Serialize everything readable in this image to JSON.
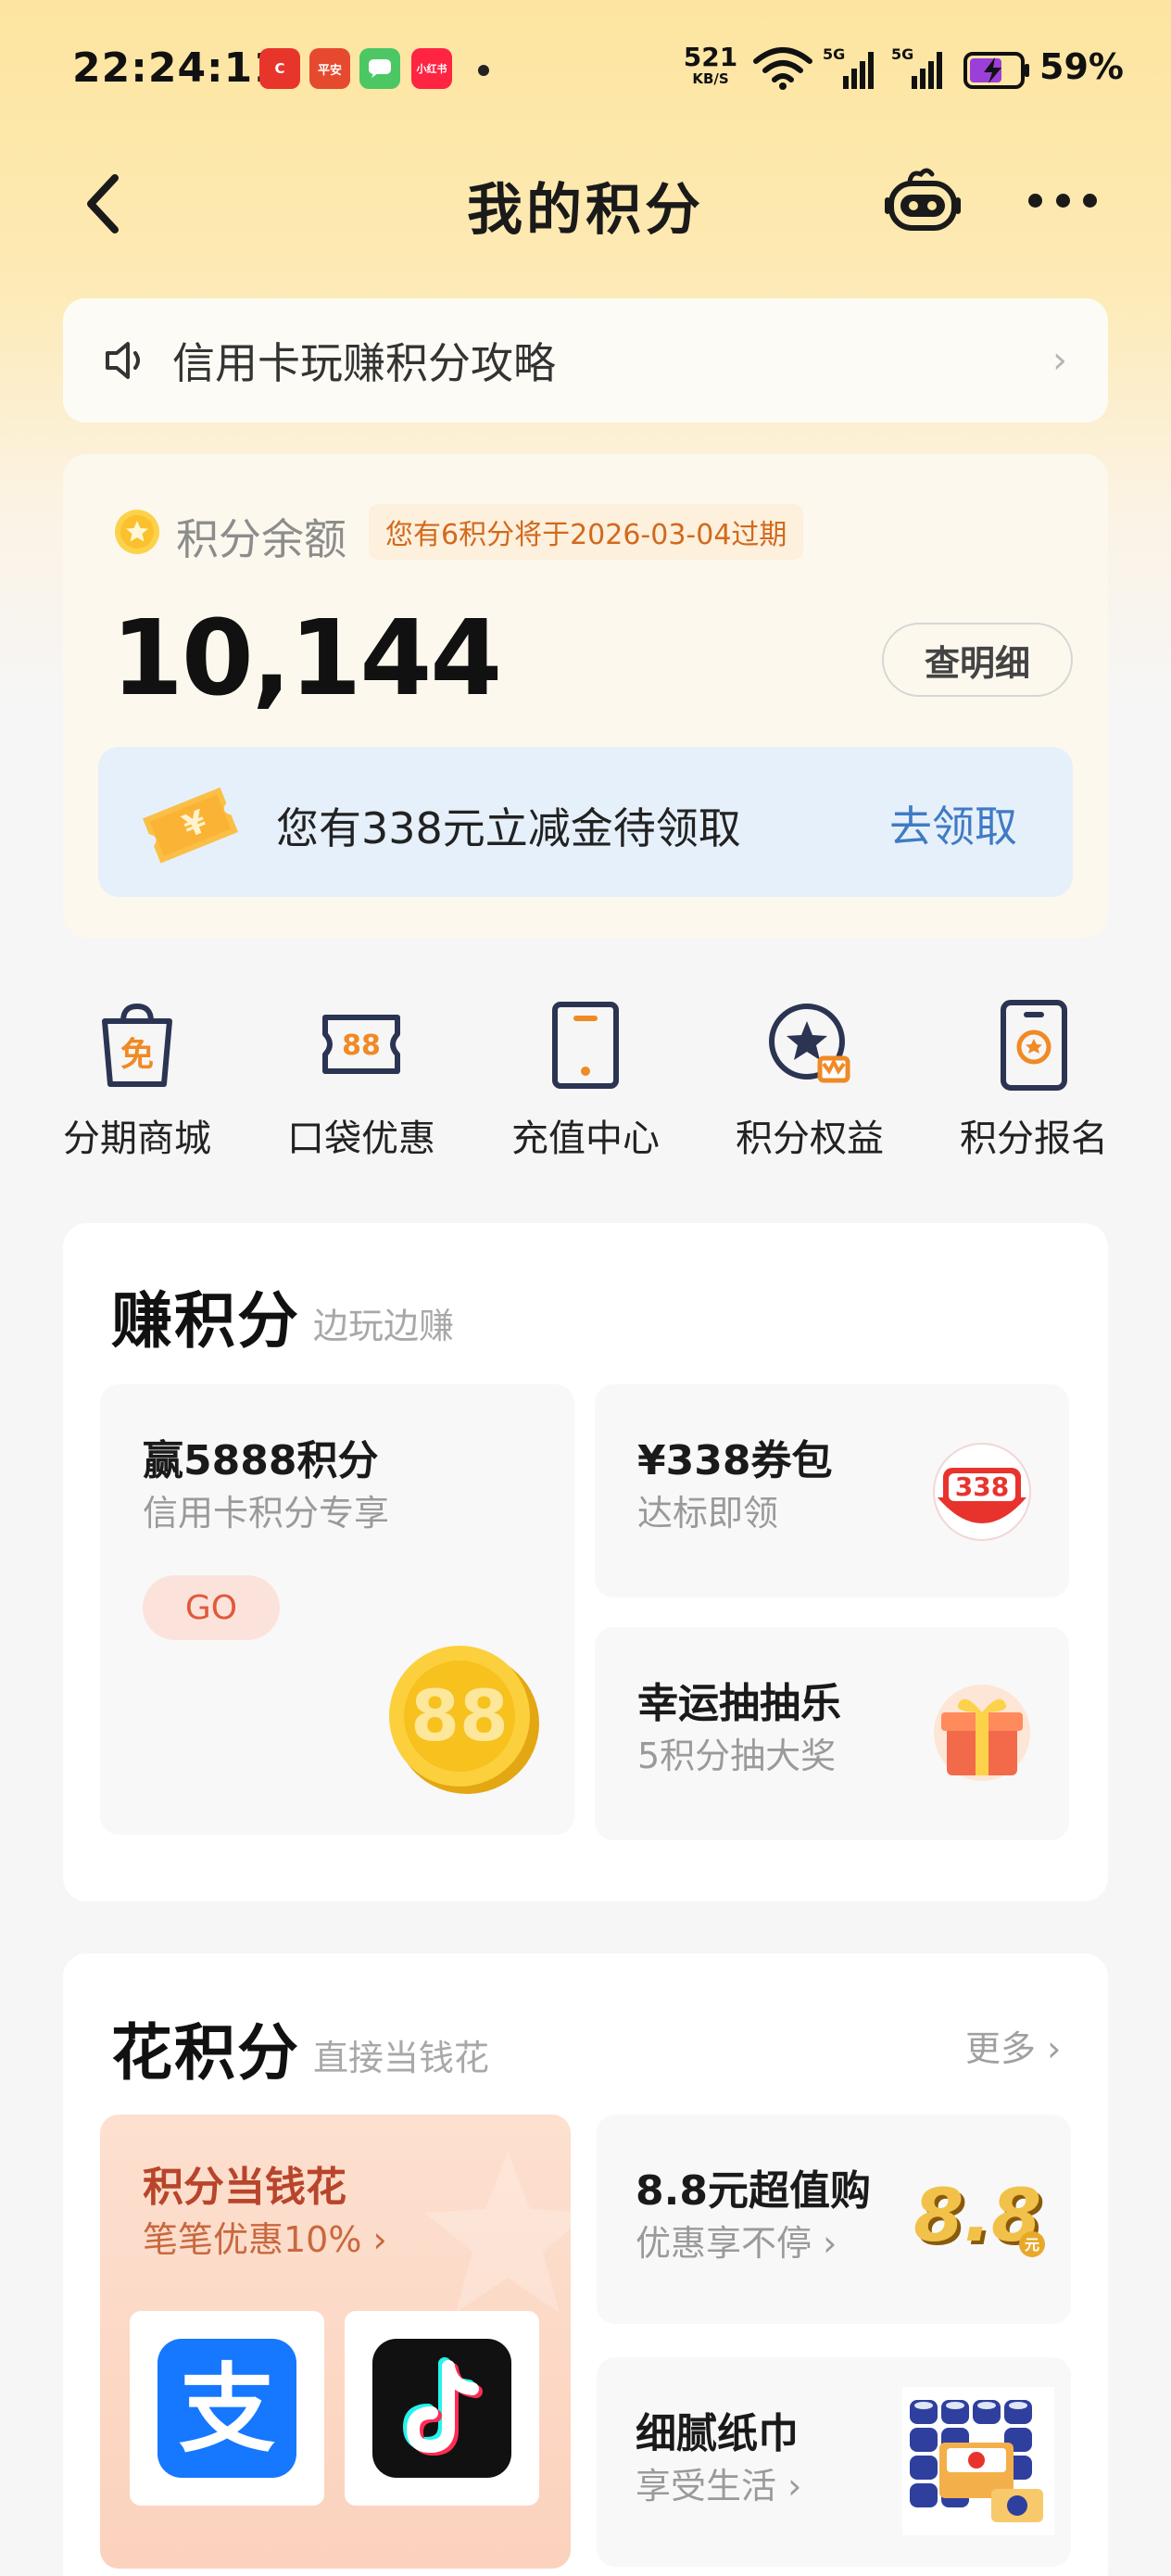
{
  "status_bar": {
    "time": "22:24:11",
    "app_badges": [
      {
        "name": "ctrip-app-icon",
        "text": "C",
        "color": "#e8352b"
      },
      {
        "name": "pingan-bank-app-icon",
        "text": "平安",
        "color": "#e64a2e"
      },
      {
        "name": "messages-app-icon",
        "text": "",
        "color": "#4cc764"
      },
      {
        "name": "xiaohongshu-app-icon",
        "text": "小红书",
        "color": "#ff2442"
      }
    ],
    "net_speed_value": "521",
    "net_speed_unit": "KB/S",
    "battery_percent": "59%"
  },
  "header": {
    "title": "我的积分"
  },
  "tips_banner": {
    "text": "信用卡玩赚积分攻略",
    "chevron": "›"
  },
  "balance": {
    "label": "积分余额",
    "expire_notice": "您有6积分将于2026-03-04过期",
    "value": "10,144",
    "detail_button": "查明细",
    "coupon_text": "您有338元立减金待领取",
    "claim_link": "去领取"
  },
  "quick_menu": [
    {
      "label": "分期商城",
      "icon": "shopping-bag-icon"
    },
    {
      "label": "口袋优惠",
      "icon": "ticket-icon"
    },
    {
      "label": "充值中心",
      "icon": "phone-icon"
    },
    {
      "label": "积分权益",
      "icon": "star-badge-icon"
    },
    {
      "label": "积分报名",
      "icon": "signup-phone-icon"
    }
  ],
  "earn": {
    "title": "赚积分",
    "subtitle": "边玩边赚",
    "big_tile": {
      "title": "赢5888积分",
      "subtitle": "信用卡积分专享",
      "button": "GO",
      "coin_text": "88"
    },
    "tiles": [
      {
        "title": "¥338券包",
        "subtitle": "达标即领",
        "badge": "338"
      },
      {
        "title": "幸运抽抽乐",
        "subtitle": "5积分抽大奖"
      }
    ]
  },
  "spend": {
    "title": "花积分",
    "subtitle": "直接当钱花",
    "more_link": "更多",
    "big_tile": {
      "title": "积分当钱花",
      "subtitle": "笔笔优惠10%",
      "alipay_glyph": "支"
    },
    "tiles": [
      {
        "title": "8.8元超值购",
        "subtitle": "优惠享不停",
        "badge": "8.8",
        "badge_unit": "元"
      },
      {
        "title": "细腻纸巾",
        "subtitle": "享受生活"
      }
    ]
  },
  "colors": {
    "accent_orange": "#e05a3a",
    "link_blue": "#3f7bc4",
    "warning_orange": "#d2691e",
    "icon_navy": "#2b3452",
    "icon_orange": "#f08a24"
  }
}
